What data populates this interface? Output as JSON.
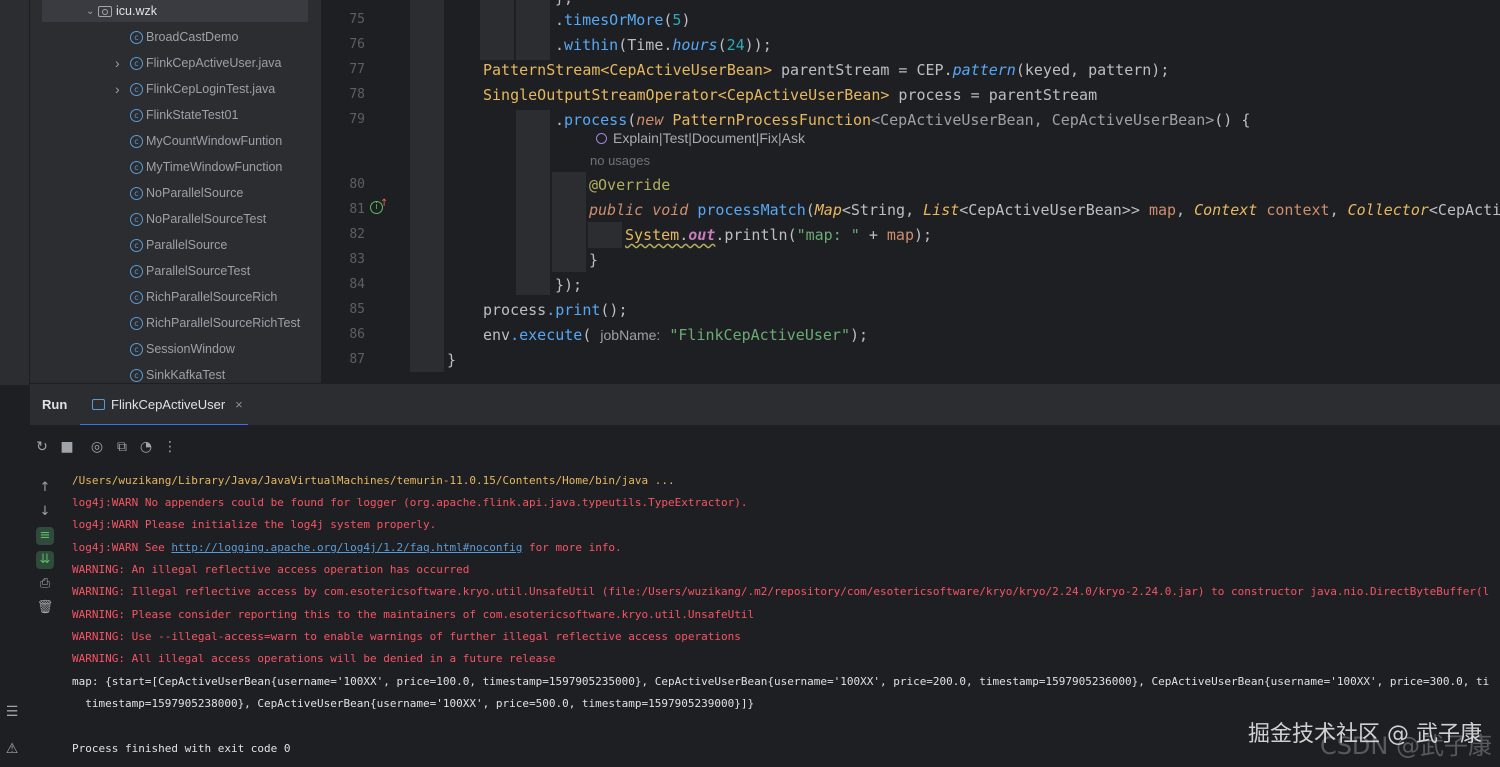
{
  "project_tree": {
    "folder": "icu.wzk",
    "items": [
      {
        "label": "BroadCastDemo",
        "expandable": false
      },
      {
        "label": "FlinkCepActiveUser.java",
        "expandable": true
      },
      {
        "label": "FlinkCepLoginTest.java",
        "expandable": true
      },
      {
        "label": "FlinkStateTest01",
        "expandable": false
      },
      {
        "label": "MyCountWindowFuntion",
        "expandable": false
      },
      {
        "label": "MyTimeWindowFunction",
        "expandable": false
      },
      {
        "label": "NoParallelSource",
        "expandable": false
      },
      {
        "label": "NoParallelSourceTest",
        "expandable": false
      },
      {
        "label": "ParallelSource",
        "expandable": false
      },
      {
        "label": "ParallelSourceTest",
        "expandable": false
      },
      {
        "label": "RichParallelSourceRich",
        "expandable": false
      },
      {
        "label": "RichParallelSourceRichTest",
        "expandable": false
      },
      {
        "label": "SessionWindow",
        "expandable": false
      },
      {
        "label": "SinkKafkaTest",
        "expandable": false
      }
    ]
  },
  "gutter": {
    "line_numbers": [
      "75",
      "76",
      "77",
      "78",
      "79",
      "80",
      "81",
      "82",
      "83",
      "84",
      "85",
      "86",
      "87"
    ]
  },
  "editor": {
    "top_fragment": "};",
    "line75": {
      "a": ".",
      "method": "timesOrMore",
      "b": "(",
      "num": "5",
      "c": ")"
    },
    "line76": {
      "a": ".",
      "method": "within",
      "b": "(Time.",
      "italic": "hours",
      "c": "(",
      "num": "24",
      "d": "));"
    },
    "line77": {
      "type": "PatternStream<CepActiveUserBean>",
      "var": " parentStream = CEP.",
      "italic": "pattern",
      "args": "(keyed, pattern);"
    },
    "line78": {
      "type": "SingleOutputStreamOperator<CepActiveUserBean>",
      "rest": " process = parentStream"
    },
    "line79": {
      "a": ".",
      "method": "process",
      "b": "(",
      "kw": "new",
      "cls": " PatternProcessFunction",
      "generic": "<CepActiveUserBean, CepActiveUserBean>",
      "c": "() {"
    },
    "ai_actions": {
      "explain": "Explain",
      "test": "Test",
      "document": "Document",
      "fix": "Fix",
      "ask": "Ask",
      "separator": " | "
    },
    "no_usages": "no usages",
    "line80": "@Override",
    "line81": {
      "kw1": "public",
      "kw2": " void",
      "method": " processMatch",
      "b": "(",
      "t1": "Map",
      "g1": "<String, ",
      "t2": "List",
      "g2": "<CepActiveUserBean>> ",
      "p1": "map",
      "sep": ", ",
      "t3": "Context",
      "p2": " context",
      "sep2": ", ",
      "t4": "Collector",
      "g3": "<CepActive"
    },
    "line82": {
      "cls": "System",
      "dot": ".",
      "field": "out",
      "method": ".println",
      "b": "(",
      "str": "\"map: \"",
      "plus": " + ",
      "var": "map",
      "c": ");"
    },
    "line83": "}",
    "line84": "});",
    "line85": {
      "var": "process",
      "method": ".print",
      "rest": "();"
    },
    "line86": {
      "var": "env",
      "method": ".execute",
      "b": "( ",
      "hint": "jobName:",
      "str": " \"FlinkCepActiveUser\"",
      "c": ");"
    },
    "line87": "}"
  },
  "run_panel": {
    "title": "Run",
    "tab_label": "FlinkCepActiveUser",
    "close_glyph": "×"
  },
  "console": {
    "lines": [
      {
        "kind": "path",
        "text": "/Users/wuzikang/Library/Java/JavaVirtualMachines/temurin-11.0.15/Contents/Home/bin/java ..."
      },
      {
        "kind": "warn",
        "text": "log4j:WARN No appenders could be found for logger (org.apache.flink.api.java.typeutils.TypeExtractor)."
      },
      {
        "kind": "warn",
        "text": "log4j:WARN Please initialize the log4j system properly."
      },
      {
        "kind": "warn-link",
        "pre": "log4j:WARN See ",
        "link": "http://logging.apache.org/log4j/1.2/faq.html#noconfig",
        "post": " for more info."
      },
      {
        "kind": "warn",
        "text": "WARNING: An illegal reflective access operation has occurred"
      },
      {
        "kind": "warn",
        "text": "WARNING: Illegal reflective access by com.esotericsoftware.kryo.util.UnsafeUtil (file:/Users/wuzikang/.m2/repository/com/esotericsoftware/kryo/kryo/2.24.0/kryo-2.24.0.jar) to constructor java.nio.DirectByteBuffer(l"
      },
      {
        "kind": "warn",
        "text": "WARNING: Please consider reporting this to the maintainers of com.esotericsoftware.kryo.util.UnsafeUtil"
      },
      {
        "kind": "warn",
        "text": "WARNING: Use --illegal-access=warn to enable warnings of further illegal reflective access operations"
      },
      {
        "kind": "warn",
        "text": "WARNING: All illegal access operations will be denied in a future release"
      },
      {
        "kind": "out",
        "text": "map: {start=[CepActiveUserBean{username='100XX', price=100.0, timestamp=1597905235000}, CepActiveUserBean{username='100XX', price=200.0, timestamp=1597905236000}, CepActiveUserBean{username='100XX', price=300.0, ti"
      },
      {
        "kind": "out",
        "text": "  timestamp=1597905238000}, CepActiveUserBean{username='100XX', price=500.0, timestamp=1597905239000}]}"
      },
      {
        "kind": "out",
        "text": ""
      },
      {
        "kind": "out",
        "text": "Process finished with exit code 0"
      }
    ]
  },
  "watermark": {
    "text": "掘金技术社区 @ 武子康",
    "faint_text": "CSDN @武子康"
  },
  "colors": {
    "background": "#1e1f22",
    "panel": "#2b2d30",
    "keyword": "#cf8e6d",
    "method": "#56a8f5",
    "number": "#2aacb8",
    "string": "#6aab73",
    "class": "#e6b85f",
    "warning": "#f75464",
    "accent": "#3574f0"
  },
  "icons": {
    "rerun": "rerun-icon",
    "stop": "stop-icon",
    "screenshot": "camera-icon",
    "restore": "restore-layout-icon",
    "settings": "settings-icon",
    "more": "more-icon",
    "up": "arrow-up-icon",
    "down": "arrow-down-icon",
    "wrap": "soft-wrap-icon",
    "scroll": "scroll-to-end-icon",
    "print": "print-icon",
    "trash": "trash-icon"
  }
}
